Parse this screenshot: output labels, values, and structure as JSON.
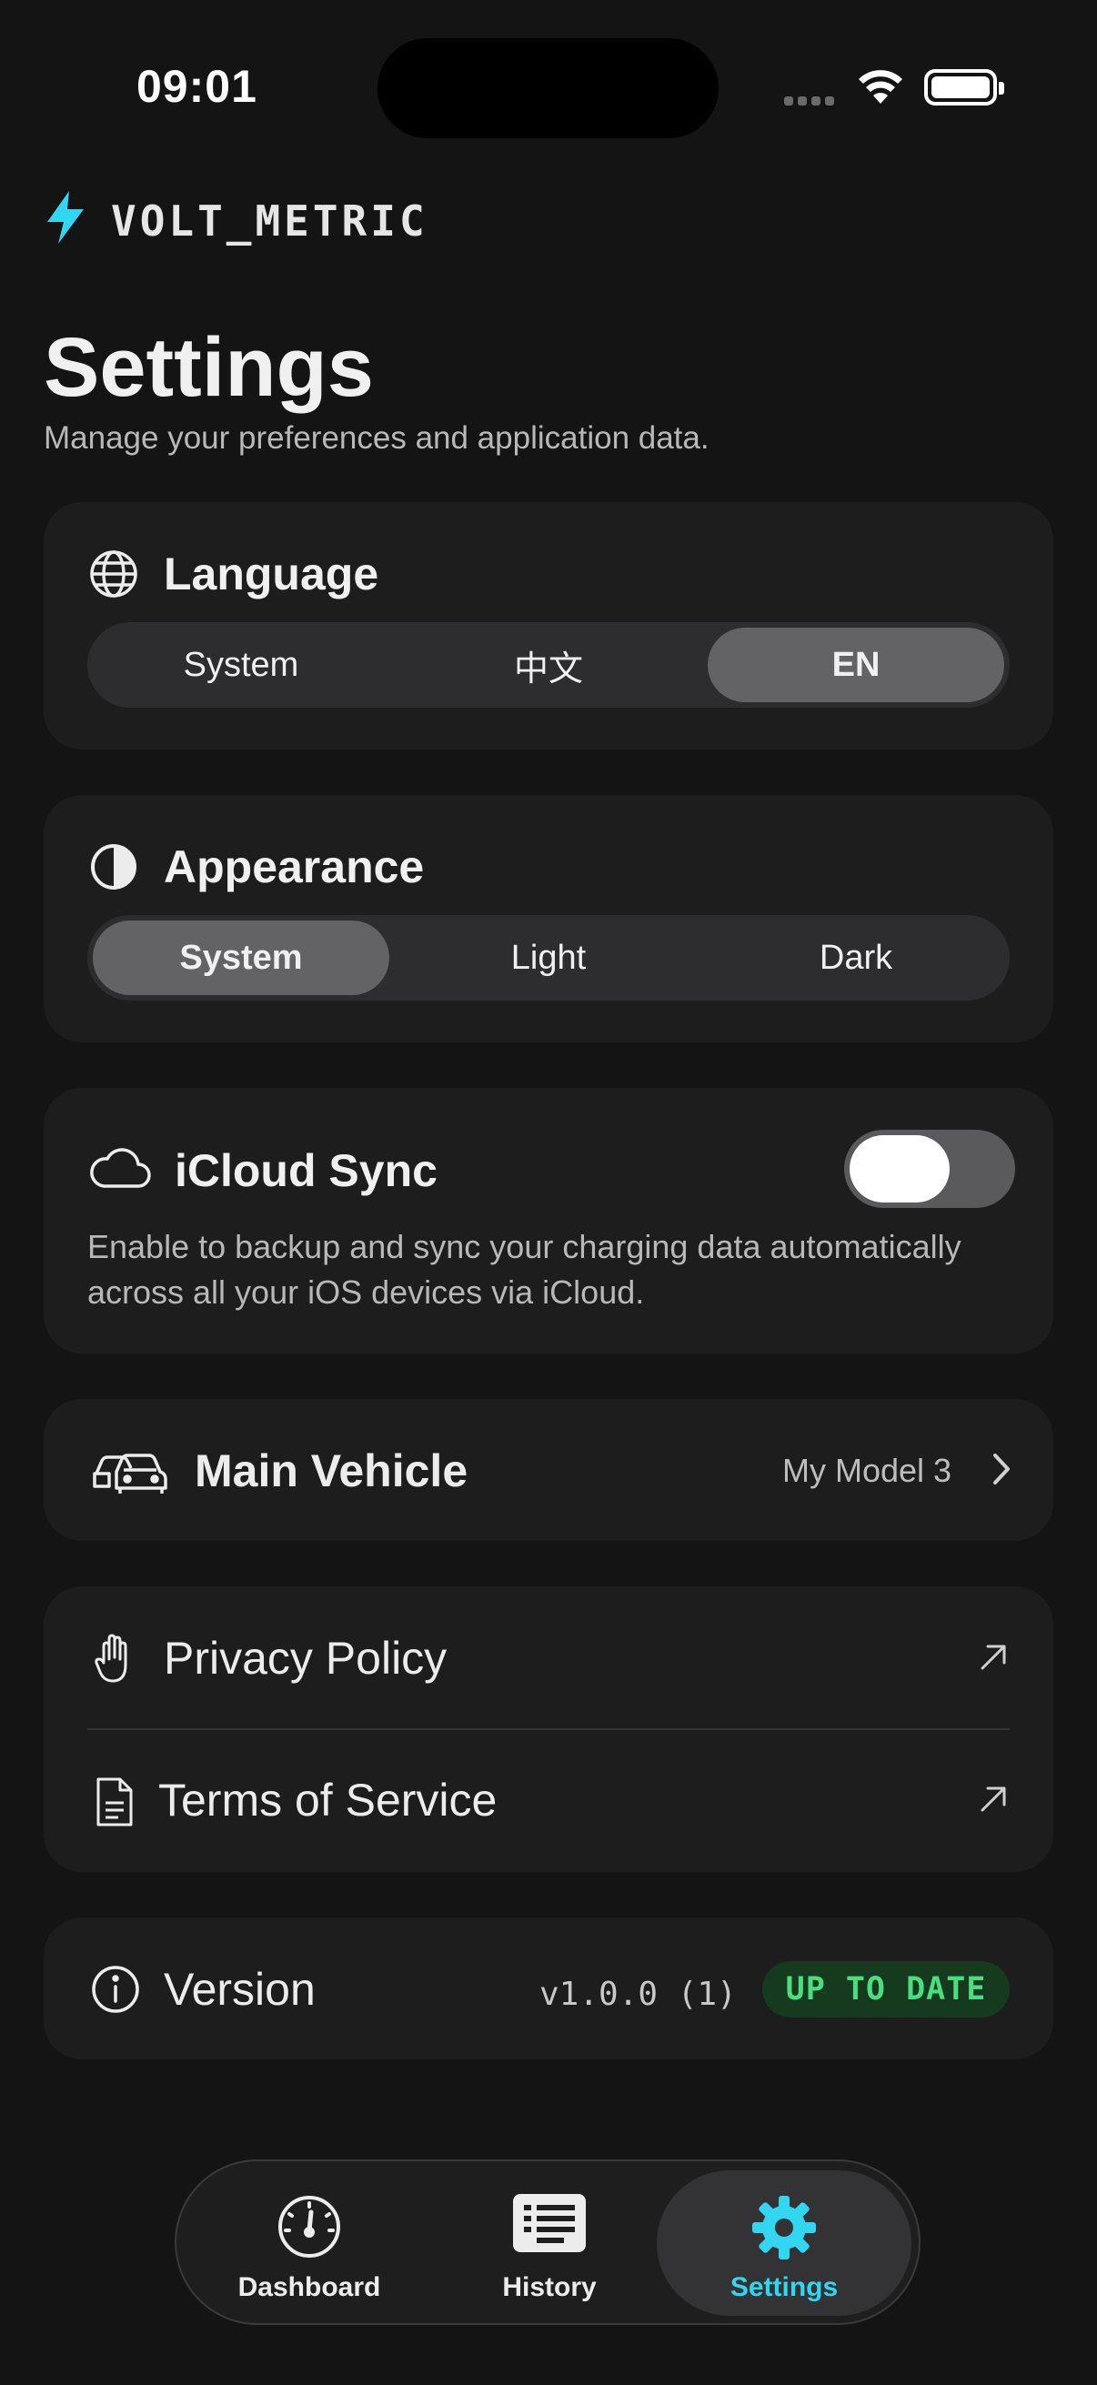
{
  "status_bar": {
    "time": "09:01"
  },
  "brand": {
    "name": "VOLT_METRIC"
  },
  "page": {
    "title": "Settings",
    "subtitle": "Manage your preferences and application data."
  },
  "language": {
    "title": "Language",
    "options": [
      "System",
      "中文",
      "EN"
    ],
    "selected": "EN"
  },
  "appearance": {
    "title": "Appearance",
    "options": [
      "System",
      "Light",
      "Dark"
    ],
    "selected": "System"
  },
  "icloud": {
    "title": "iCloud Sync",
    "enabled": false,
    "description": "Enable to backup and sync your charging data automatically across all your iOS devices via iCloud."
  },
  "vehicle": {
    "label": "Main Vehicle",
    "value": "My Model 3"
  },
  "legal": {
    "privacy": "Privacy Policy",
    "terms": "Terms of Service"
  },
  "version": {
    "label": "Version",
    "value": "v1.0.0 (1)",
    "status": "UP TO DATE"
  },
  "tabs": [
    {
      "label": "Dashboard",
      "icon": "gauge-icon",
      "active": false
    },
    {
      "label": "History",
      "icon": "list-icon",
      "active": false
    },
    {
      "label": "Settings",
      "icon": "gear-icon",
      "active": true
    }
  ],
  "colors": {
    "accent": "#33d6f0",
    "success": "#4ade80",
    "background": "#141414",
    "card": "#1d1d1d"
  }
}
